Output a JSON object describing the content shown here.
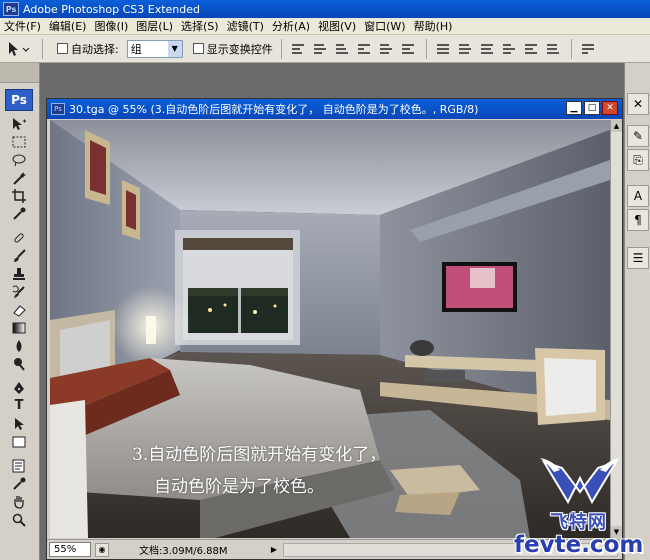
{
  "app": {
    "title": "Adobe Photoshop CS3 Extended",
    "logo": "Ps"
  },
  "menu": [
    "文件(F)",
    "编辑(E)",
    "图像(I)",
    "图层(L)",
    "选择(S)",
    "滤镜(T)",
    "分析(A)",
    "视图(V)",
    "窗口(W)",
    "帮助(H)"
  ],
  "options": {
    "auto_select_label": "自动选择:",
    "auto_select_value": "组",
    "show_transform_label": "显示变换控件"
  },
  "document": {
    "title": "30.tga @ 55% (3.自动色阶后图就开始有变化了，    自动色阶是为了校色。, RGB/8)",
    "zoom": "55%",
    "doc_size": "文档:3.09M/6.88M",
    "caption_line1": "3.自动色阶后图就开始有变化了，",
    "caption_line2": "自动色阶是为了校色。"
  },
  "watermark": {
    "cn": "飞特网",
    "en": "fevte.com"
  },
  "colors": {
    "titlebar": "#0846b8",
    "menubar": "#ece9d8",
    "panel": "#d4d0c8",
    "workspace": "#6b6b6b"
  },
  "icons": [
    "move-tool-icon",
    "marquee-icon",
    "lasso-icon",
    "magic-wand-icon",
    "crop-icon",
    "eyedropper-icon",
    "healing-brush-icon",
    "brush-icon",
    "stamp-icon",
    "history-brush-icon",
    "eraser-icon",
    "gradient-icon",
    "blur-icon",
    "dodge-icon",
    "pen-icon",
    "type-icon",
    "path-select-icon",
    "shape-icon",
    "notes-icon",
    "eyedropper2-icon",
    "hand-icon",
    "zoom-icon"
  ]
}
